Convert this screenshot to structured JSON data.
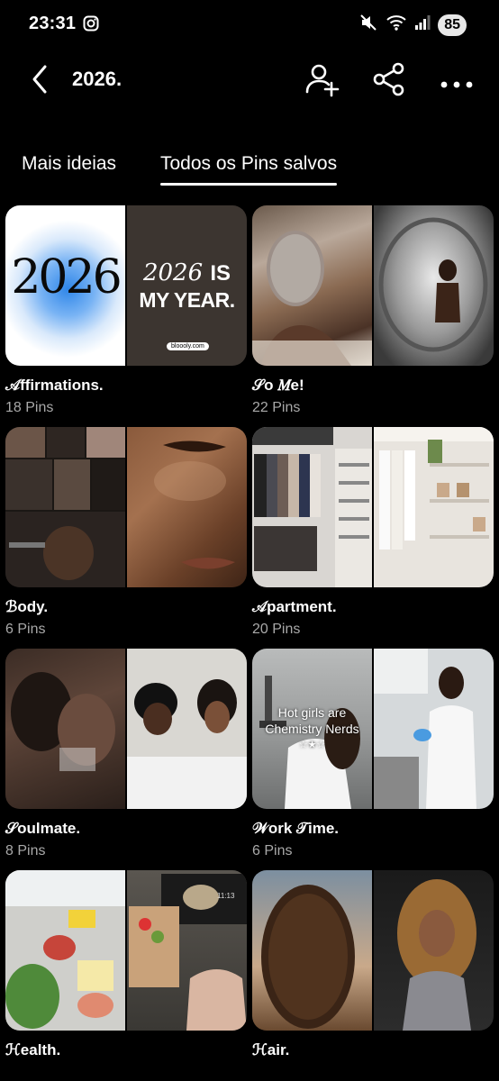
{
  "status": {
    "time": "23:31",
    "battery": "85"
  },
  "header": {
    "title": "2026."
  },
  "tabs": [
    {
      "label": "Mais ideias"
    },
    {
      "label": "Todos os Pins salvos"
    }
  ],
  "boards": [
    {
      "name": "𝒜ffirmations.",
      "count": "18 Pins",
      "cover": {
        "left_text": "2026",
        "right_year": "2026",
        "right_is": "IS",
        "right_line2": "MY YEAR.",
        "right_badge": "bloooly.com"
      }
    },
    {
      "name": "𝒮o 𝑀e!",
      "count": "22 Pins"
    },
    {
      "name": "ℬody.",
      "count": "6 Pins"
    },
    {
      "name": "𝒜partment.",
      "count": "20 Pins"
    },
    {
      "name": "𝒮oulmate.",
      "count": "8 Pins"
    },
    {
      "name": "𝒲ork 𝒯ime.",
      "count": "6 Pins",
      "cover": {
        "caption_line1": "Hot girls are",
        "caption_line2": "Chemistry Nerds",
        "stars": "☆★☆"
      }
    },
    {
      "name": "ℋealth.",
      "count": "",
      "cover": {
        "clock": "11:13"
      }
    },
    {
      "name": "ℋair.",
      "count": ""
    }
  ]
}
